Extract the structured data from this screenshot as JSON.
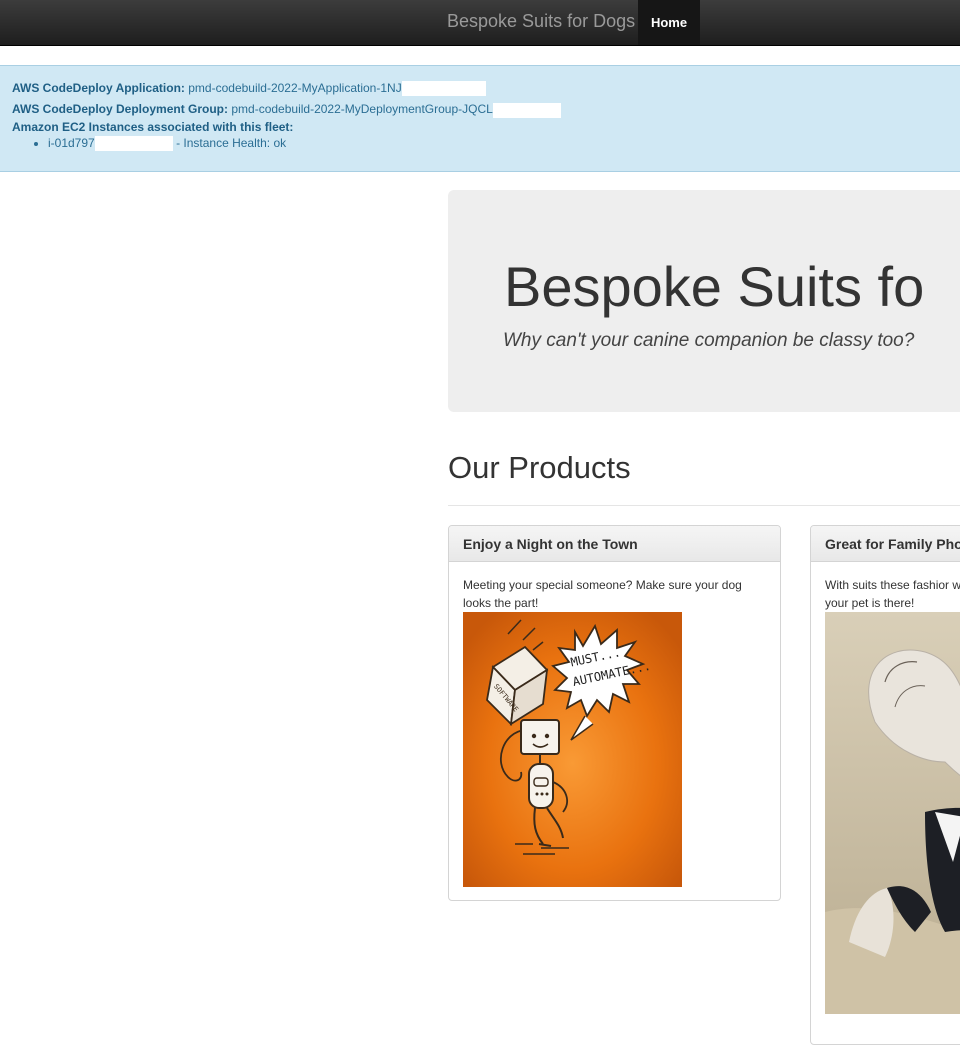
{
  "navbar": {
    "brand": "Bespoke Suits for Dogs",
    "home_label": "Home"
  },
  "info": {
    "application_label": "AWS CodeDeploy Application:",
    "application_value": "pmd-codebuild-2022-MyApplication-1NJ",
    "deployment_group_label": "AWS CodeDeploy Deployment Group:",
    "deployment_group_value": "pmd-codebuild-2022-MyDeploymentGroup-JQCL",
    "instances_label": "Amazon EC2 Instances associated with this fleet:",
    "instances": [
      {
        "id": "i-01d797",
        "health": "- Instance Health: ok"
      }
    ]
  },
  "jumbotron": {
    "title": "Bespoke Suits fo",
    "subtitle": "Why can't your canine companion be classy too?"
  },
  "products": {
    "title": "Our Products",
    "items": [
      {
        "heading": "Enjoy a Night on the Town",
        "text": "Meeting your special someone? Make sure your dog looks the part!",
        "image": {
          "alt": "robot-carrying-software-box",
          "speech_line1": "MUST...",
          "speech_line2": "AUTOMATE...",
          "box_label": "SOFTWARE"
        }
      },
      {
        "heading": "Great for Family Pho",
        "text": "With suits these fashior why your pet is there!"
      }
    ]
  },
  "colors": {
    "navbar_bg": "#222222",
    "info_bg": "#d0e8f4",
    "info_text": "#2b6e94",
    "jumbotron_bg": "#eeeeee",
    "robot_orange": "#ea7416"
  }
}
